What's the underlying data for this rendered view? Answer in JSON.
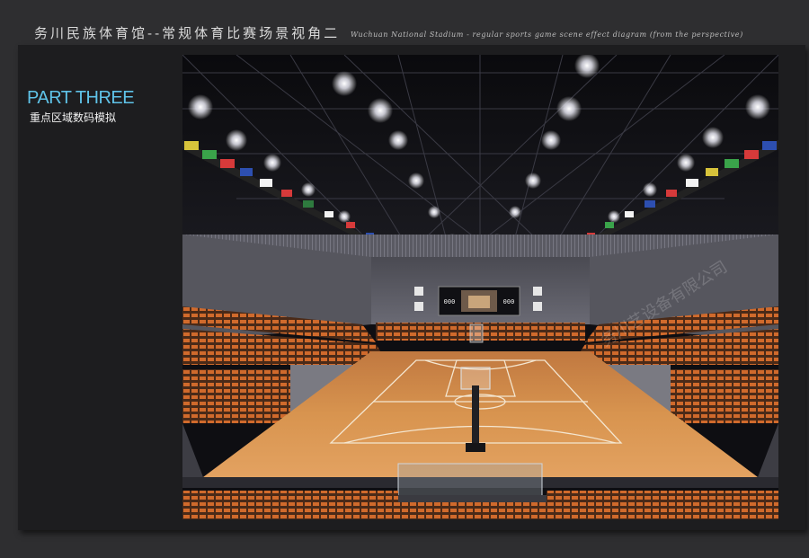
{
  "header": {
    "title_cn": "务川民族体育馆--常规体育比赛场景视角二",
    "title_en": "Wuchuan National Stadium - regular sports game scene effect diagram (from the perspective)"
  },
  "section": {
    "title": "PART THREE",
    "subtitle": "重点区域数码模拟"
  },
  "scoreboard": {
    "left_score": "000",
    "right_score": "000"
  },
  "watermark": {
    "text": "务川艺设备有限公司"
  },
  "colors": {
    "accent": "#5fc3e8",
    "panel": "#1d1d1f",
    "page": "#2e2e30",
    "seat": "#c8642a",
    "court": "#d6904e"
  },
  "image": {
    "icon": "arena-rendering-image"
  }
}
